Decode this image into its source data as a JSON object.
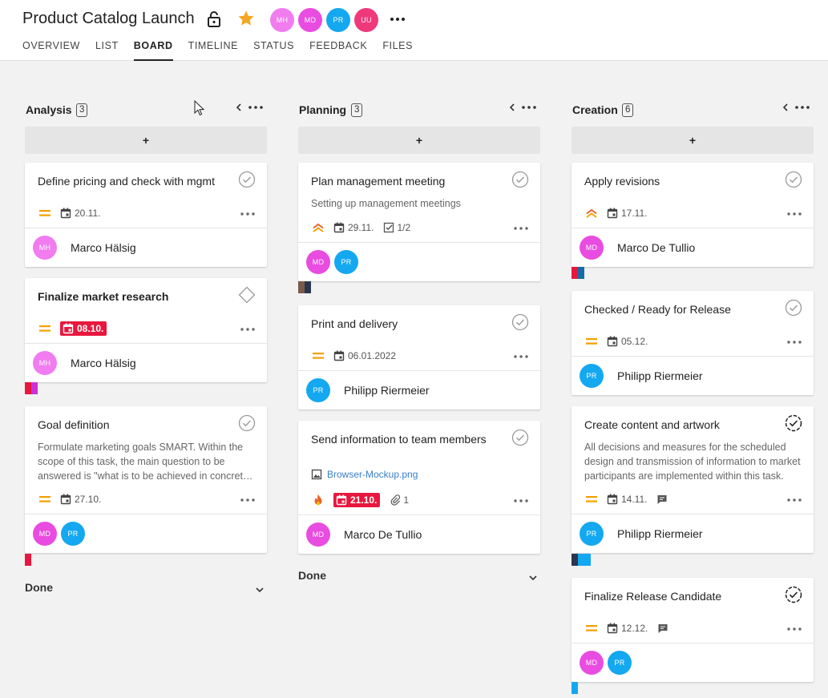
{
  "header": {
    "title": "Product Catalog Launch",
    "avatars": [
      {
        "initials": "MH",
        "color": "#f07cf0"
      },
      {
        "initials": "MD",
        "color": "#e94ce0"
      },
      {
        "initials": "PR",
        "color": "#14a8f0"
      },
      {
        "initials": "UU",
        "color": "#f0397a"
      }
    ],
    "icons": {
      "lock": "lock-open-icon",
      "star": "star-icon",
      "more": "more-horizontal-icon"
    },
    "star_color": "#f5a623"
  },
  "tabs": [
    {
      "label": "OVERVIEW",
      "active": false
    },
    {
      "label": "LIST",
      "active": false
    },
    {
      "label": "BOARD",
      "active": true
    },
    {
      "label": "TIMELINE",
      "active": false
    },
    {
      "label": "STATUS",
      "active": false
    },
    {
      "label": "FEEDBACK",
      "active": false
    },
    {
      "label": "FILES",
      "active": false
    }
  ],
  "colors": {
    "overdue": "#e8173e",
    "priority_medium": "#f5a000",
    "priority_high": "#e8622a",
    "link": "#3a7fc4"
  },
  "columns": [
    {
      "name": "Analysis",
      "count": "3",
      "add_label": "+",
      "done_label": "Done",
      "cards": [
        {
          "title": "Define pricing and check with mgmt",
          "status": "check",
          "priority": "medium",
          "date": "20.11.",
          "overdue": false,
          "person": "Marco Hälsig",
          "avatars": [
            {
              "initials": "MH",
              "color": "#f07cf0"
            }
          ],
          "tags": []
        },
        {
          "title": "Finalize market research",
          "bold": true,
          "status": "diamond",
          "priority": "medium",
          "date": "08.10.",
          "overdue": true,
          "person": "Marco Hälsig",
          "avatars": [
            {
              "initials": "MH",
              "color": "#f07cf0"
            }
          ],
          "tags": [
            "#e8173e",
            "#c832d8"
          ]
        },
        {
          "title": "Goal definition",
          "status": "check",
          "description": "Formulate marketing goals SMART. Within the scope of this task, the main question to be answered is \"what is to be achieved in concrete terms\".",
          "priority": "medium",
          "date": "27.10.",
          "overdue": false,
          "avatars": [
            {
              "initials": "MD",
              "color": "#e94ce0"
            },
            {
              "initials": "PR",
              "color": "#14a8f0"
            }
          ],
          "tags": [
            "#e8173e"
          ]
        }
      ]
    },
    {
      "name": "Planning",
      "count": "3",
      "add_label": "+",
      "done_label": "Done",
      "cards": [
        {
          "title": "Plan management meeting",
          "status": "check",
          "description": "Setting up management meetings",
          "priority": "high",
          "date": "29.11.",
          "overdue": false,
          "checklist": "1/2",
          "avatars": [
            {
              "initials": "MD",
              "color": "#e94ce0"
            },
            {
              "initials": "PR",
              "color": "#14a8f0"
            }
          ],
          "tags": [
            "#7a5a4a",
            "#2a3550"
          ]
        },
        {
          "title": "Print and delivery",
          "status": "check",
          "priority": "medium",
          "date": "06.01.2022",
          "overdue": false,
          "person": "Philipp Riermeier",
          "avatars": [
            {
              "initials": "PR",
              "color": "#14a8f0"
            }
          ],
          "tags": []
        },
        {
          "title": "Send information to team members",
          "status": "check",
          "file": "Browser-Mockup.png",
          "priority": "fire",
          "date": "21.10.",
          "overdue": true,
          "attachments": "1",
          "person": "Marco De Tullio",
          "avatars": [
            {
              "initials": "MD",
              "color": "#e94ce0"
            }
          ],
          "tags": []
        }
      ]
    },
    {
      "name": "Creation",
      "count": "6",
      "add_label": "+",
      "cards": [
        {
          "title": "Apply revisions",
          "status": "check",
          "priority": "high",
          "date": "17.11.",
          "overdue": false,
          "person": "Marco De Tullio",
          "avatars": [
            {
              "initials": "MD",
              "color": "#e94ce0"
            }
          ],
          "tags": [
            "#e8173e",
            "#1a6aa8"
          ]
        },
        {
          "title": "Checked / Ready for Release",
          "status": "check",
          "priority": "medium",
          "date": "05.12.",
          "overdue": false,
          "person": "Philipp Riermeier",
          "avatars": [
            {
              "initials": "PR",
              "color": "#14a8f0"
            }
          ],
          "tags": []
        },
        {
          "title": "Create content and artwork",
          "status": "check-dashed",
          "description": "All decisions and measures for the scheduled design and transmission of information to market participants are implemented within this task.",
          "priority": "medium",
          "date": "14.11.",
          "overdue": false,
          "comments": true,
          "person": "Philipp Riermeier",
          "avatars": [
            {
              "initials": "PR",
              "color": "#14a8f0"
            }
          ],
          "tags": [
            "#2a3550",
            "#14a8f0",
            "#14a8f0"
          ]
        },
        {
          "title": "Finalize Release Candidate",
          "status": "check-dashed",
          "priority": "medium",
          "date": "12.12.",
          "overdue": false,
          "comments": true,
          "avatars": [
            {
              "initials": "MD",
              "color": "#e94ce0"
            },
            {
              "initials": "PR",
              "color": "#14a8f0"
            }
          ],
          "tags": [
            "#14a8f0"
          ]
        }
      ]
    }
  ]
}
